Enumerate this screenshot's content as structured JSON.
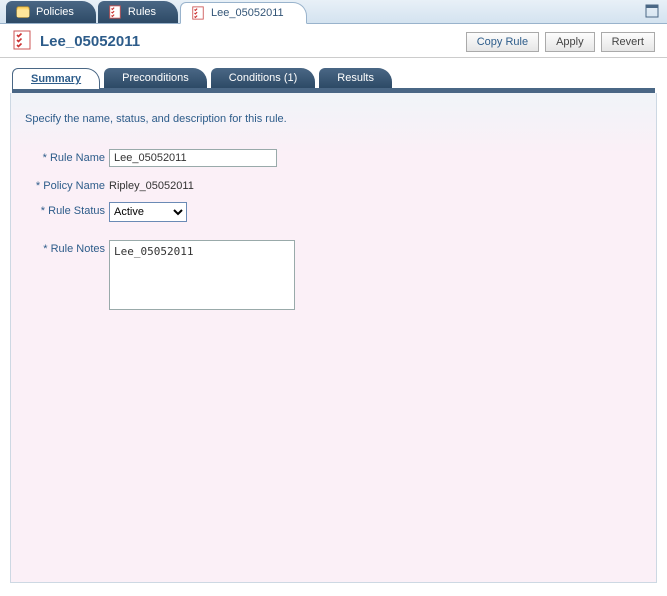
{
  "outerTabs": {
    "policies": "Policies",
    "rules": "Rules",
    "current": "Lee_05052011"
  },
  "toolbar": {
    "title": "Lee_05052011",
    "copy": "Copy Rule",
    "apply": "Apply",
    "revert": "Revert"
  },
  "innerTabs": {
    "summary": "Summary",
    "preconditions": "Preconditions",
    "conditions": "Conditions (1)",
    "results": "Results"
  },
  "intro": "Specify the name, status, and description for this rule.",
  "form": {
    "ruleNameLabel": "Rule Name",
    "ruleNameValue": "Lee_05052011",
    "policyNameLabel": "Policy Name",
    "policyNameValue": "Ripley_05052011",
    "ruleStatusLabel": "Rule Status",
    "ruleStatusValue": "Active",
    "ruleNotesLabel": "Rule Notes",
    "ruleNotesValue": "Lee_05052011"
  }
}
